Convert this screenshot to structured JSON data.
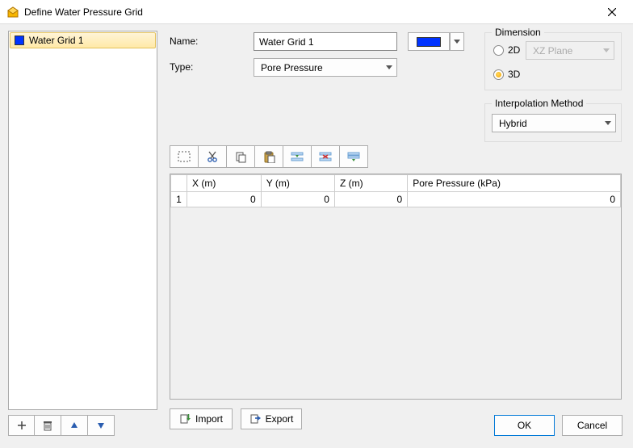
{
  "window": {
    "title": "Define Water Pressure Grid"
  },
  "left_list": {
    "items": [
      {
        "label": "Water Grid 1",
        "color": "#0033ff"
      }
    ]
  },
  "form": {
    "name_label": "Name:",
    "name_value": "Water Grid 1",
    "type_label": "Type:",
    "type_value": "Pore Pressure",
    "color": "#0033ff"
  },
  "dimension": {
    "legend": "Dimension",
    "opt2d_label": "2D",
    "opt3d_label": "3D",
    "plane_value": "XZ Plane",
    "selected": "3D"
  },
  "interp": {
    "legend": "Interpolation Method",
    "value": "Hybrid"
  },
  "table": {
    "headers": {
      "x": "X (m)",
      "y": "Y (m)",
      "z": "Z (m)",
      "pp": "Pore Pressure (kPa)"
    },
    "rows": [
      {
        "n": "1",
        "x": "0",
        "y": "0",
        "z": "0",
        "pp": "0"
      }
    ]
  },
  "buttons": {
    "import": "Import",
    "export": "Export",
    "ok": "OK",
    "cancel": "Cancel"
  }
}
